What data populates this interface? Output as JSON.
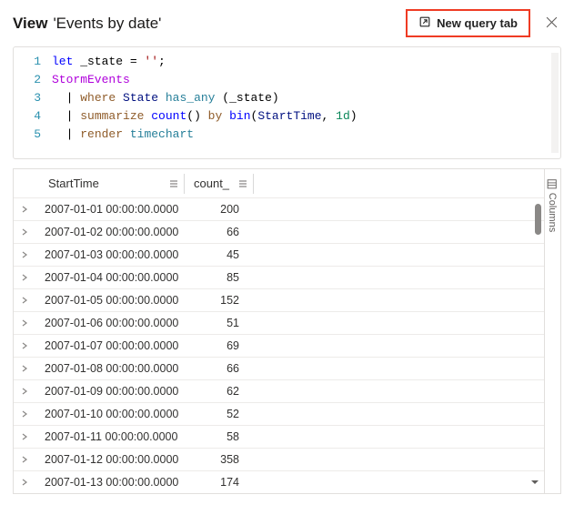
{
  "header": {
    "prefix": "View",
    "title": "'Events by date'",
    "new_query_label": "New query tab"
  },
  "query": {
    "lines": [
      "1",
      "2",
      "3",
      "4",
      "5"
    ]
  },
  "columns": {
    "start": "StartTime",
    "count": "count_"
  },
  "sidebar": {
    "columns_label": "Columns"
  },
  "rows": [
    {
      "start": "2007-01-01 00:00:00.0000",
      "count": "200"
    },
    {
      "start": "2007-01-02 00:00:00.0000",
      "count": "66"
    },
    {
      "start": "2007-01-03 00:00:00.0000",
      "count": "45"
    },
    {
      "start": "2007-01-04 00:00:00.0000",
      "count": "85"
    },
    {
      "start": "2007-01-05 00:00:00.0000",
      "count": "152"
    },
    {
      "start": "2007-01-06 00:00:00.0000",
      "count": "51"
    },
    {
      "start": "2007-01-07 00:00:00.0000",
      "count": "69"
    },
    {
      "start": "2007-01-08 00:00:00.0000",
      "count": "66"
    },
    {
      "start": "2007-01-09 00:00:00.0000",
      "count": "62"
    },
    {
      "start": "2007-01-10 00:00:00.0000",
      "count": "52"
    },
    {
      "start": "2007-01-11 00:00:00.0000",
      "count": "58"
    },
    {
      "start": "2007-01-12 00:00:00.0000",
      "count": "358"
    },
    {
      "start": "2007-01-13 00:00:00.0000",
      "count": "174"
    }
  ]
}
